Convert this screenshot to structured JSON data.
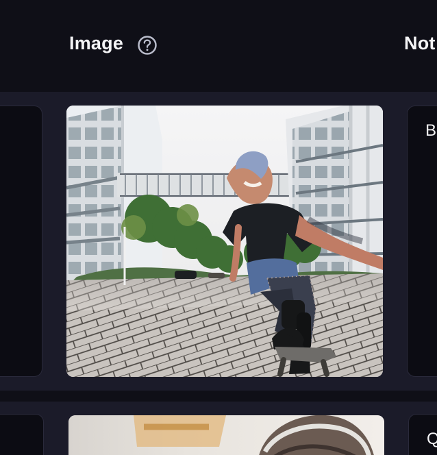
{
  "header": {
    "image_column_title": "Image",
    "notes_column_title": "Not",
    "help_icon": "help-circle-icon"
  },
  "rows": [
    {
      "image_description_icon": "photo",
      "notes_preview": "B"
    },
    {
      "image_description_icon": "photo",
      "notes_preview": "Q"
    }
  ],
  "colors": {
    "background": "#0f0f17",
    "row_background": "#1b1b29",
    "card_background": "#0c0c13",
    "text": "#f4f4f6",
    "icon": "#b9bccb"
  }
}
